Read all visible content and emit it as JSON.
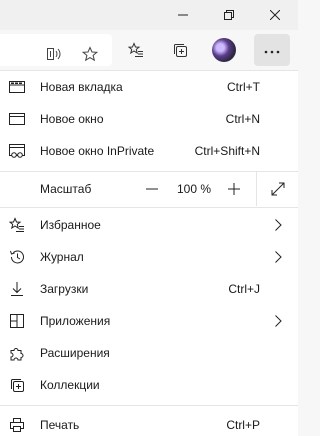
{
  "titlebar": {
    "minimize_icon": "minimize-icon",
    "restore_icon": "restore-icon",
    "close_icon": "close-icon"
  },
  "toolbar": {
    "icons": [
      "read-aloud-icon",
      "favorite-star-icon",
      "favorites-icon",
      "collections-icon",
      "profile-avatar",
      "more-icon"
    ]
  },
  "menu": {
    "new_tab": {
      "label": "Новая вкладка",
      "shortcut": "Ctrl+T"
    },
    "new_window": {
      "label": "Новое окно",
      "shortcut": "Ctrl+N"
    },
    "new_inprivate": {
      "label": "Новое окно InPrivate",
      "shortcut": "Ctrl+Shift+N"
    },
    "zoom": {
      "label": "Масштаб",
      "minus": "—",
      "value": "100 %",
      "plus": "+"
    },
    "favorites": {
      "label": "Избранное"
    },
    "history": {
      "label": "Журнал"
    },
    "downloads": {
      "label": "Загрузки",
      "shortcut": "Ctrl+J"
    },
    "apps": {
      "label": "Приложения"
    },
    "extensions": {
      "label": "Расширения"
    },
    "collections": {
      "label": "Коллекции"
    },
    "print": {
      "label": "Печать",
      "shortcut": "Ctrl+P"
    }
  }
}
